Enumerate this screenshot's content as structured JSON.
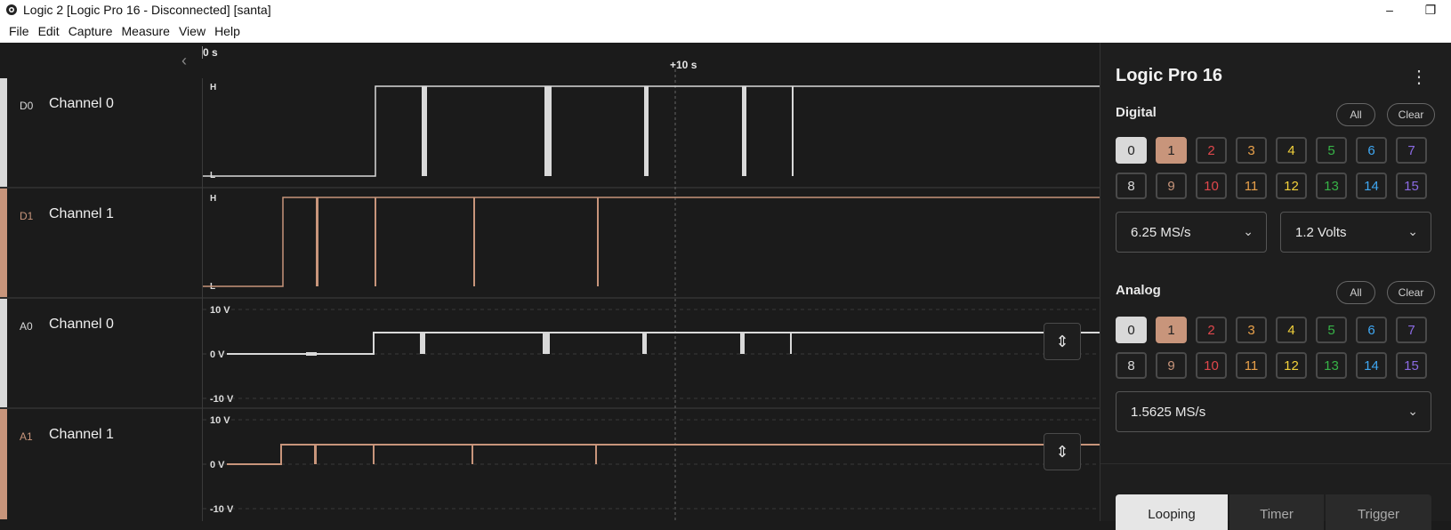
{
  "window": {
    "title": "Logic 2 [Logic Pro 16 - Disconnected] [santa]",
    "minimize": "–",
    "restore": "❐"
  },
  "menu": [
    "File",
    "Edit",
    "Capture",
    "Measure",
    "View",
    "Help"
  ],
  "timeline": {
    "start_label": "0 s",
    "mark_label": "+10 s",
    "collapse_icon": "chevron-left-icon"
  },
  "channels": [
    {
      "id": "D0",
      "name": "Channel 0",
      "type": "digital",
      "color": "#d9d9d9",
      "hi": "H",
      "lo": "L"
    },
    {
      "id": "D1",
      "name": "Channel 1",
      "type": "digital",
      "color": "#c8957b",
      "hi": "H",
      "lo": "L"
    },
    {
      "id": "A0",
      "name": "Channel 0",
      "type": "analog",
      "color": "#d9d9d9",
      "top": "10 V",
      "mid": "0 V",
      "bot": "-10 V"
    },
    {
      "id": "A1",
      "name": "Channel 1",
      "type": "analog",
      "color": "#c8957b",
      "top": "10 V",
      "mid": "0 V",
      "bot": "-10 V"
    }
  ],
  "panel": {
    "title": "Logic Pro 16",
    "menu_icon": "kebab-menu-icon",
    "digital": {
      "title": "Digital",
      "all": "All",
      "clear": "Clear",
      "channels": [
        "0",
        "1",
        "2",
        "3",
        "4",
        "5",
        "6",
        "7",
        "8",
        "9",
        "10",
        "11",
        "12",
        "13",
        "14",
        "15"
      ],
      "selected": [
        "0",
        "1"
      ],
      "sample_rate": "6.25 MS/s",
      "voltage": "1.2 Volts"
    },
    "analog": {
      "title": "Analog",
      "all": "All",
      "clear": "Clear",
      "channels": [
        "0",
        "1",
        "2",
        "3",
        "4",
        "5",
        "6",
        "7",
        "8",
        "9",
        "10",
        "11",
        "12",
        "13",
        "14",
        "15"
      ],
      "selected": [
        "0",
        "1"
      ],
      "sample_rate": "1.5625 MS/s"
    },
    "tabs": [
      "Looping",
      "Timer",
      "Trigger"
    ],
    "active_tab": "Looping"
  },
  "colors": {
    "ch": [
      "#d9d9d9",
      "#c8957b",
      "#e0474c",
      "#e8a04a",
      "#f2d13b",
      "#37b347",
      "#3fa7f2",
      "#8b6be3",
      "#d9d9d9",
      "#c8957b",
      "#e0474c",
      "#e8a04a",
      "#f2d13b",
      "#37b347",
      "#3fa7f2",
      "#8b6be3"
    ]
  }
}
